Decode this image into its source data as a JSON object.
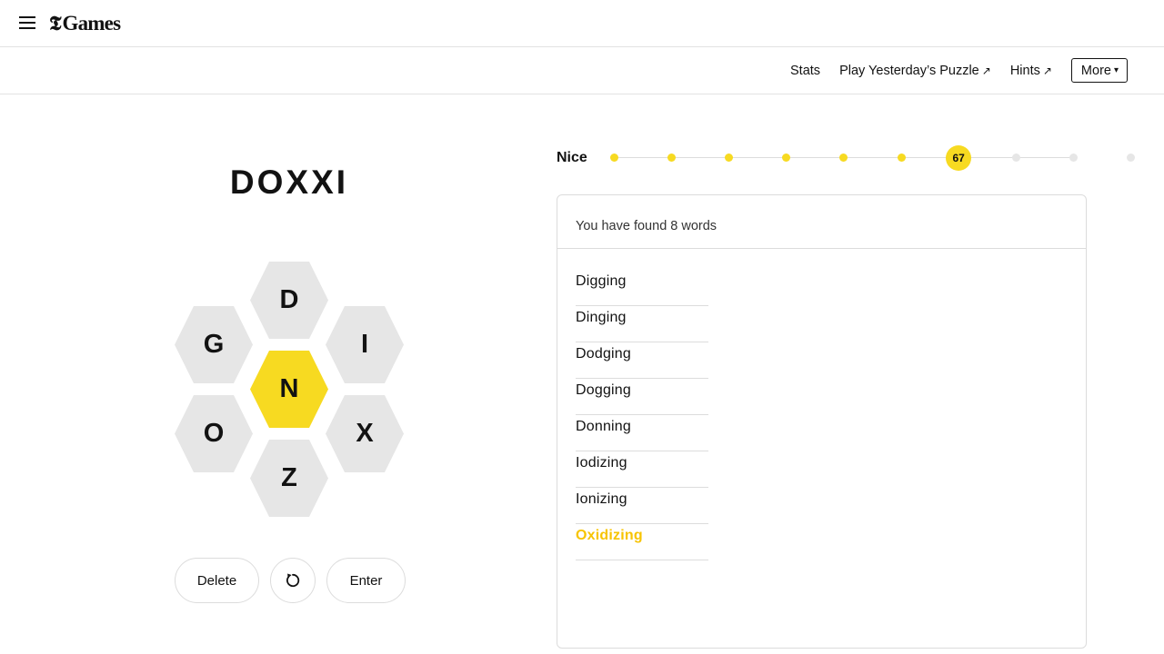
{
  "header": {
    "menu_icon": "hamburger-menu-icon",
    "brand_mark": "𝕿",
    "brand_text": "Games"
  },
  "toolbar": {
    "stats_label": "Stats",
    "yesterday_label": "Play Yesterday’s Puzzle",
    "yesterday_arrow": "↗",
    "hints_label": "Hints",
    "hints_arrow": "↗",
    "more_label": "More",
    "more_caret": "▾"
  },
  "game": {
    "current_input": "DOXXI",
    "hive": {
      "center": "N",
      "top": "D",
      "upper_left": "G",
      "upper_right": "I",
      "lower_left": "O",
      "lower_right": "X",
      "bottom": "Z"
    },
    "controls": {
      "delete_label": "Delete",
      "shuffle_icon": "shuffle-icon",
      "enter_label": "Enter"
    }
  },
  "progress": {
    "rank": "Nice",
    "score": "67",
    "levels_total": 10,
    "current_level_index": 6
  },
  "wordpanel": {
    "found_text": "You have found 8 words",
    "words": [
      {
        "text": "Digging",
        "pangram": false
      },
      {
        "text": "Dinging",
        "pangram": false
      },
      {
        "text": "Dodging",
        "pangram": false
      },
      {
        "text": "Dogging",
        "pangram": false
      },
      {
        "text": "Donning",
        "pangram": false
      },
      {
        "text": "Iodizing",
        "pangram": false
      },
      {
        "text": "Ionizing",
        "pangram": false
      },
      {
        "text": "Oxidizing",
        "pangram": true
      }
    ]
  },
  "colors": {
    "accent_yellow": "#f7da21",
    "cell_gray": "#e6e6e6",
    "text": "#121212"
  }
}
